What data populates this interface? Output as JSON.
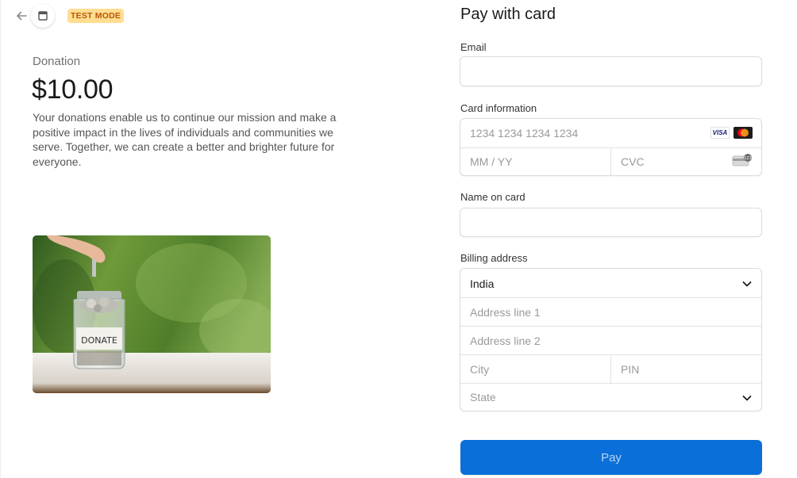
{
  "header": {
    "badge": "TEST MODE"
  },
  "product": {
    "name": "Donation",
    "amount": "$10.00",
    "description": "Your donations enable us to continue our mission and make a positive impact in the lives of individuals and communities we serve. Together, we can create a better and brighter future for everyone.",
    "image_text": "DONATE"
  },
  "form": {
    "title": "Pay with card",
    "email": {
      "label": "Email",
      "value": ""
    },
    "card": {
      "label": "Card information",
      "number_placeholder": "1234 1234 1234 1234",
      "expiry_placeholder": "MM / YY",
      "cvc_placeholder": "CVC",
      "brands": [
        "VISA",
        "mastercard"
      ]
    },
    "name": {
      "label": "Name on card",
      "value": ""
    },
    "billing": {
      "label": "Billing address",
      "country": "India",
      "address1_placeholder": "Address line 1",
      "address2_placeholder": "Address line 2",
      "city_placeholder": "City",
      "pin_placeholder": "PIN",
      "state_placeholder": "State"
    },
    "pay_label": "Pay"
  },
  "colors": {
    "accent": "#0a6fd8",
    "badge_bg": "#ffde92",
    "badge_text": "#bb5504"
  }
}
